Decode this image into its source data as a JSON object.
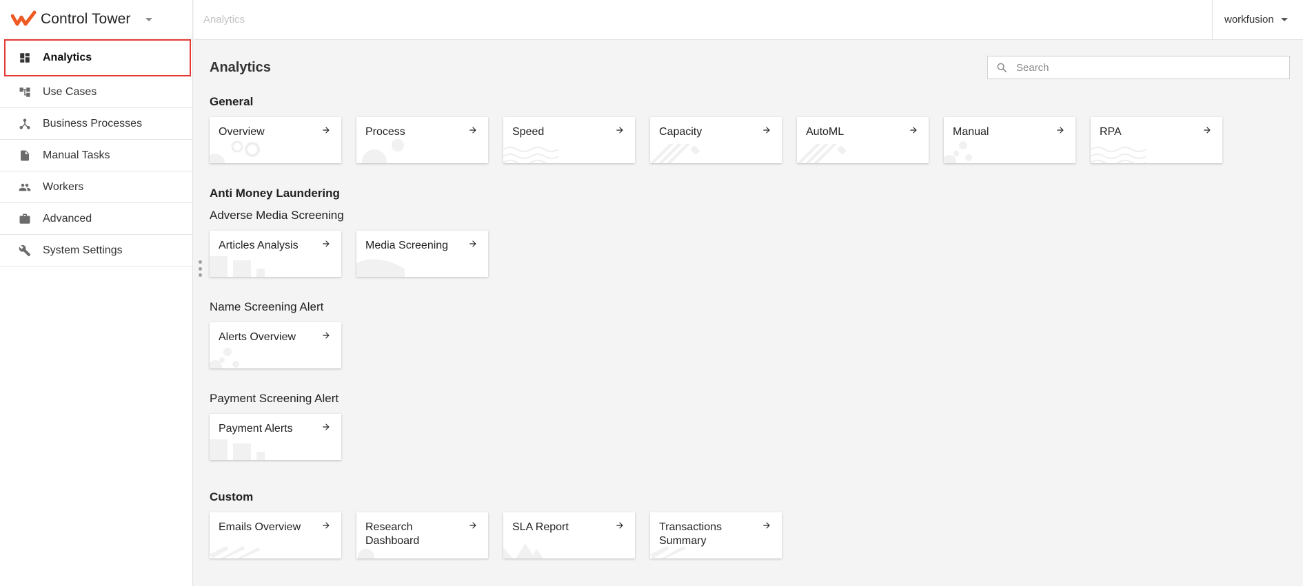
{
  "app": {
    "title": "Control Tower",
    "brand_color": "#ef5a24",
    "accent_highlight": "#e53935"
  },
  "header": {
    "breadcrumb": "Analytics",
    "user": "workfusion"
  },
  "sidebar": {
    "items": [
      {
        "label": "Analytics",
        "icon": "dashboard-icon",
        "active": true
      },
      {
        "label": "Use Cases",
        "icon": "tree-icon"
      },
      {
        "label": "Business Processes",
        "icon": "process-icon"
      },
      {
        "label": "Manual Tasks",
        "icon": "document-icon"
      },
      {
        "label": "Workers",
        "icon": "people-icon"
      },
      {
        "label": "Advanced",
        "icon": "briefcase-icon"
      },
      {
        "label": "System Settings",
        "icon": "wrench-icon"
      }
    ]
  },
  "main": {
    "title": "Analytics",
    "search": {
      "placeholder": "Search",
      "value": ""
    },
    "sections": {
      "general": {
        "title": "General",
        "cards": [
          "Overview",
          "Process",
          "Speed",
          "Capacity",
          "AutoML",
          "Manual",
          "RPA"
        ]
      },
      "aml": {
        "title": "Anti Money Laundering",
        "groups": {
          "adverse": {
            "title": "Adverse Media Screening",
            "cards": [
              "Articles Analysis",
              "Media Screening"
            ]
          },
          "name": {
            "title": "Name Screening Alert",
            "cards": [
              "Alerts Overview"
            ]
          },
          "payment": {
            "title": "Payment Screening Alert",
            "cards": [
              "Payment Alerts"
            ]
          }
        }
      },
      "custom": {
        "title": "Custom",
        "cards": [
          "Emails Overview",
          "Research Dashboard",
          "SLA Report",
          "Transactions Summary"
        ]
      }
    }
  }
}
